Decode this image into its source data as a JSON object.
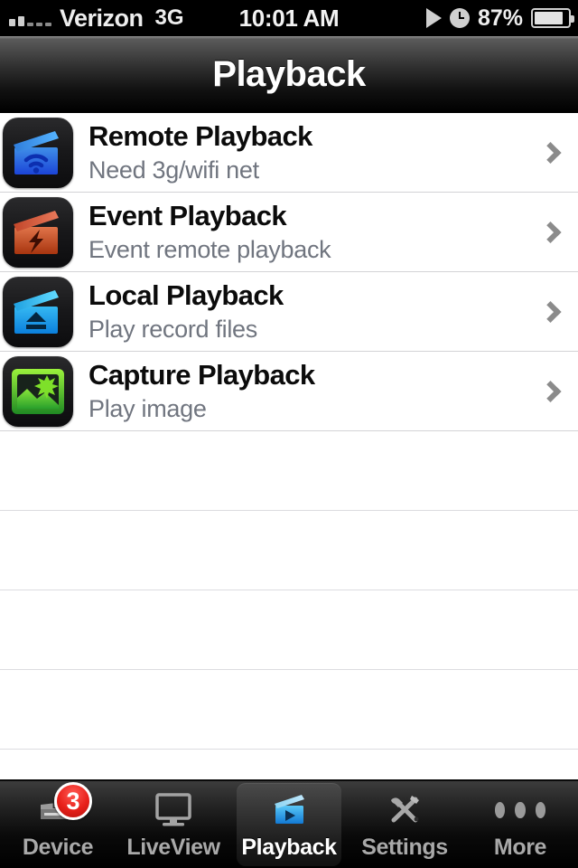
{
  "status_bar": {
    "carrier": "Verizon",
    "network": "3G",
    "time": "10:01 AM",
    "battery_percent": "87%",
    "signal_icon": "signal-bars-icon",
    "play_icon": "play-triangle-icon",
    "alarm_icon": "alarm-clock-icon",
    "battery_icon": "battery-icon"
  },
  "nav_bar": {
    "title": "Playback"
  },
  "list": {
    "rows": [
      {
        "title": "Remote Playback",
        "subtitle": "Need 3g/wifi net",
        "icon": "clapperboard-wifi-icon",
        "accessory": "chevron-right-icon"
      },
      {
        "title": "Event Playback",
        "subtitle": "Event remote playback",
        "icon": "clapperboard-bolt-icon",
        "accessory": "chevron-right-icon"
      },
      {
        "title": "Local Playback",
        "subtitle": "Play record files",
        "icon": "clapperboard-eject-icon",
        "accessory": "chevron-right-icon"
      },
      {
        "title": "Capture Playback",
        "subtitle": "Play image",
        "icon": "photo-sun-icon",
        "accessory": "chevron-right-icon"
      }
    ],
    "empty_row_count": 5
  },
  "tab_bar": {
    "tabs": [
      {
        "label": "Device",
        "icon": "dvr-icon",
        "selected": false,
        "badge": "3"
      },
      {
        "label": "LiveView",
        "icon": "monitor-icon",
        "selected": false,
        "badge": ""
      },
      {
        "label": "Playback",
        "icon": "clapperboard-play-icon",
        "selected": true,
        "badge": ""
      },
      {
        "label": "Settings",
        "icon": "tools-icon",
        "selected": false,
        "badge": ""
      },
      {
        "label": "More",
        "icon": "ellipsis-icon",
        "selected": false,
        "badge": ""
      }
    ]
  },
  "colors": {
    "accent_blue": "#29a6ef",
    "badge_red": "#e8201a",
    "subtitle_gray": "#70757f",
    "chevron_gray": "#8b8b8b"
  }
}
